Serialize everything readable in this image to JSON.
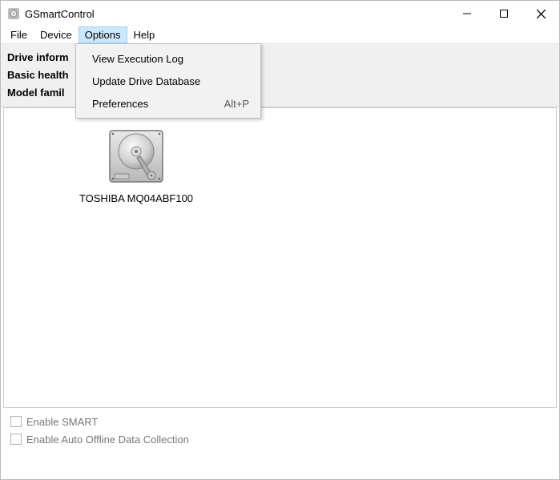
{
  "window": {
    "title": "GSmartControl"
  },
  "menubar": {
    "items": [
      "File",
      "Device",
      "Options",
      "Help"
    ],
    "open_index": 2
  },
  "dropdown": {
    "items": [
      {
        "label": "View Execution Log",
        "accel": ""
      },
      {
        "label": "Update Drive Database",
        "accel": ""
      },
      {
        "label": "Preferences",
        "accel": "Alt+P"
      }
    ]
  },
  "info": {
    "row1": "Drive inform",
    "row2": "Basic health",
    "row3": "Model famil"
  },
  "drive": {
    "label": "TOSHIBA MQ04ABF100"
  },
  "bottom": {
    "enable_smart": "Enable SMART",
    "enable_auto_offline": "Enable Auto Offline Data Collection"
  }
}
